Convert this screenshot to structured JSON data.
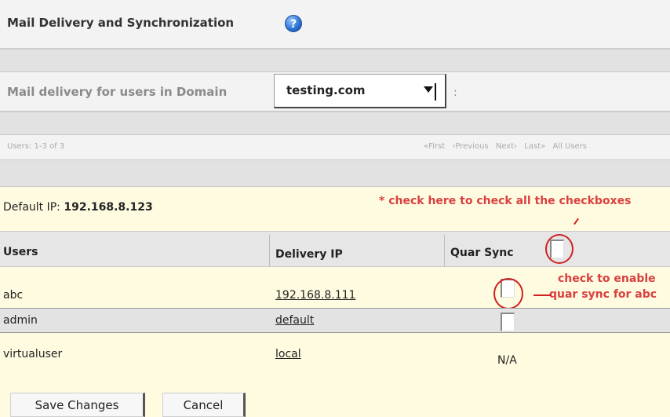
{
  "header": {
    "title": "Mail Delivery and Synchronization",
    "help_icon": "help-icon"
  },
  "domain": {
    "label": "Mail delivery for users in Domain",
    "selected": "testing.com",
    "suffix": ":"
  },
  "pager": {
    "count": "Users: 1-3 of 3",
    "first": "«First",
    "previous": "‹Previous",
    "next": "Next›",
    "last": "Last»",
    "all": "All Users"
  },
  "default_ip": {
    "label": "Default IP: ",
    "value": "192.168.8.123"
  },
  "annotations": {
    "check_all": "* check here to check all the checkboxes",
    "row_note_1": "check to enable",
    "row_note_2": "quar sync for abc"
  },
  "table": {
    "columns": [
      "Users",
      "Delivery IP",
      "Quar Sync"
    ],
    "rows": [
      {
        "user": "abc",
        "ip": "192.168.8.111",
        "quar": ""
      },
      {
        "user": "admin",
        "ip": "default",
        "quar": ""
      },
      {
        "user": "virtualuser",
        "ip": "local",
        "quar": "N/A"
      }
    ]
  },
  "buttons": {
    "save": "Save Changes",
    "cancel": "Cancel"
  },
  "colors": {
    "annotation_red": "#d02020",
    "highlight_yellow": "#fffbe0"
  }
}
